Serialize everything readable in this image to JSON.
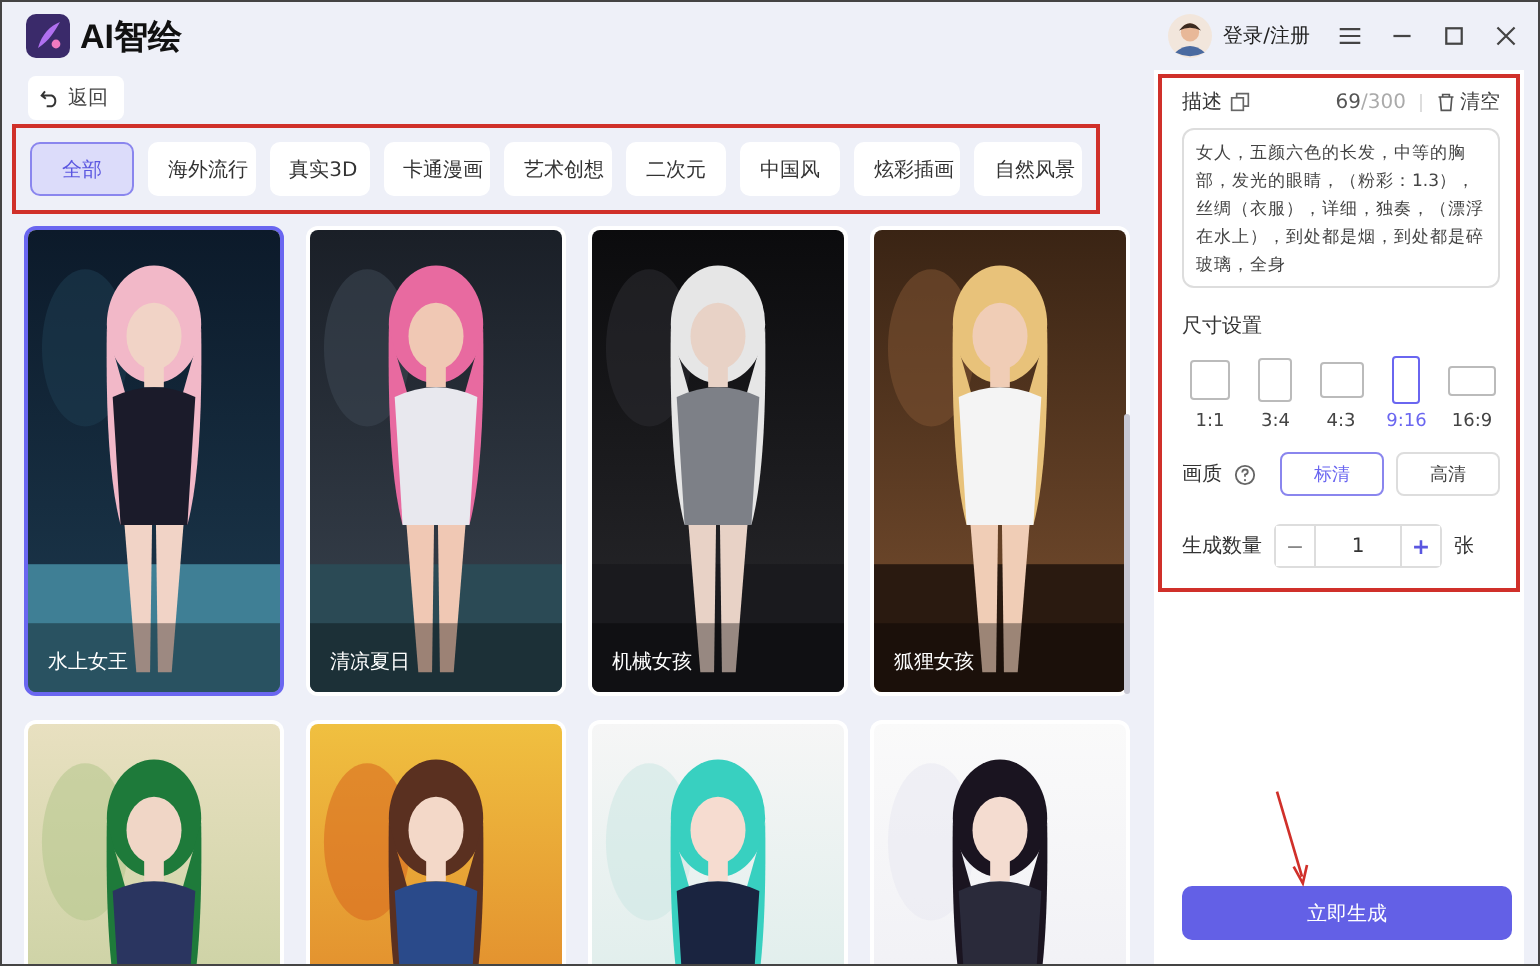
{
  "window": {
    "title": "AI智绘"
  },
  "account": {
    "label": "登录/注册"
  },
  "back_button": {
    "label": "返回"
  },
  "categories": [
    {
      "label": "全部",
      "selected": true
    },
    {
      "label": "海外流行",
      "selected": false
    },
    {
      "label": "真实3D",
      "selected": false
    },
    {
      "label": "卡通漫画",
      "selected": false
    },
    {
      "label": "艺术创想",
      "selected": false
    },
    {
      "label": "二次元",
      "selected": false
    },
    {
      "label": "中国风",
      "selected": false
    },
    {
      "label": "炫彩插画",
      "selected": false
    },
    {
      "label": "自然风景",
      "selected": false
    }
  ],
  "gallery": [
    {
      "kind": "picture",
      "caption": "水上女王",
      "selected": true
    },
    {
      "kind": "picture",
      "caption": "清凉夏日",
      "selected": false
    },
    {
      "kind": "picture",
      "caption": "机械女孩",
      "selected": false
    },
    {
      "kind": "picture",
      "caption": "狐狸女孩",
      "selected": false
    },
    {
      "kind": "picture",
      "selected": false
    },
    {
      "kind": "picture",
      "selected": false
    },
    {
      "kind": "picture",
      "selected": false
    },
    {
      "kind": "picture",
      "selected": false
    }
  ],
  "settings": {
    "description": {
      "label": "描述",
      "count": "69",
      "limit": "/300",
      "clear": "清空",
      "text": "女人，五颜六色的长发，中等的胸部，发光的眼睛，（粉彩：1.3），丝绸（衣服），详细，独奏，（漂浮在水上），到处都是烟，到处都是碎玻璃，全身"
    },
    "size": {
      "label": "尺寸设置",
      "options": [
        {
          "label": "1:1",
          "selected": false
        },
        {
          "label": "3:4",
          "selected": false
        },
        {
          "label": "4:3",
          "selected": false
        },
        {
          "label": "9:16",
          "selected": true
        },
        {
          "label": "16:9",
          "selected": false
        }
      ]
    },
    "quality": {
      "label": "画质",
      "options": [
        {
          "label": "标清",
          "selected": true
        },
        {
          "label": "高清",
          "selected": false
        }
      ]
    },
    "quantity": {
      "label": "生成数量",
      "decrement": "−",
      "value": "1",
      "increment": "+",
      "unit": "张"
    }
  },
  "generate_button": {
    "label": "立即生成"
  }
}
